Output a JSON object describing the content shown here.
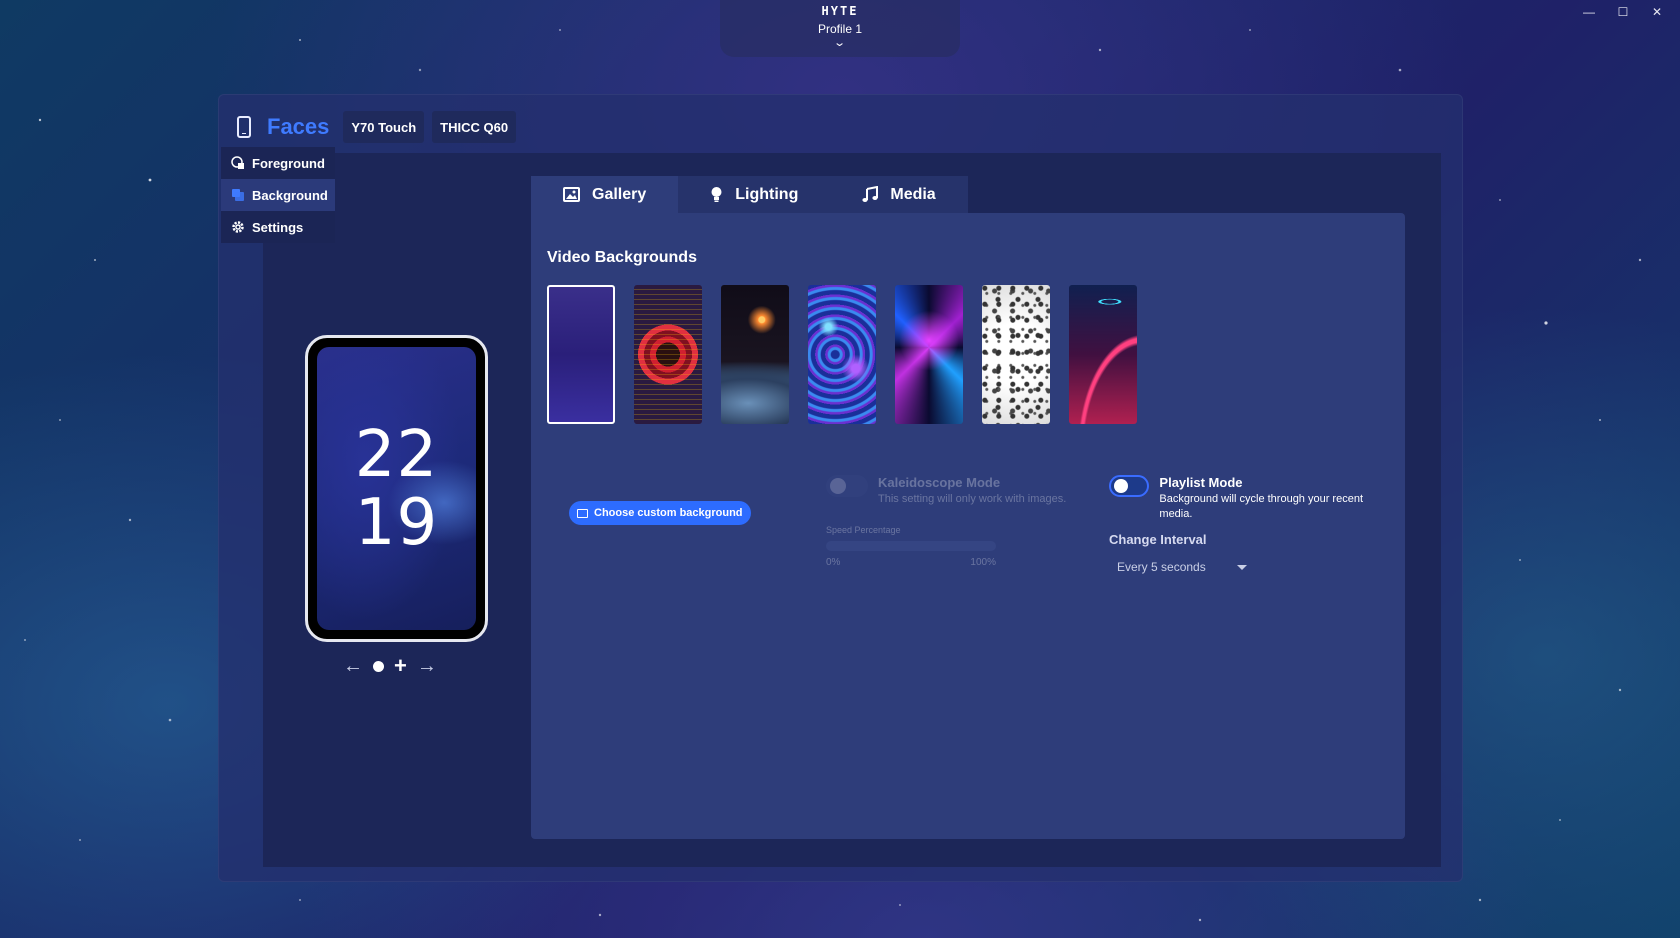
{
  "app": {
    "brand": "HYTE",
    "profile": "Profile 1"
  },
  "window_controls": {
    "minimize": "—",
    "maximize": "☐",
    "close": "✕"
  },
  "header": {
    "title": "Faces",
    "devices": [
      "Y70 Touch",
      "THICC Q60"
    ]
  },
  "sidebar": {
    "items": [
      {
        "label": "Foreground",
        "icon": "foreground-icon",
        "active": false
      },
      {
        "label": "Background",
        "icon": "background-icon",
        "active": true
      },
      {
        "label": "Settings",
        "icon": "gear-icon",
        "active": false
      }
    ]
  },
  "preview": {
    "hour": "22",
    "minute": "19",
    "pager": {
      "prev": "←",
      "add": "+",
      "next": "→"
    }
  },
  "tabs": [
    {
      "label": "Gallery",
      "icon": "image-icon",
      "active": true
    },
    {
      "label": "Lighting",
      "icon": "bulb-icon",
      "active": false
    },
    {
      "label": "Media",
      "icon": "music-icon",
      "active": false
    }
  ],
  "gallery": {
    "section_title": "Video Backgrounds",
    "thumbnails": [
      {
        "name": "purple-space",
        "selected": true
      },
      {
        "name": "red-tunnel",
        "selected": false
      },
      {
        "name": "earth-sunrise",
        "selected": false
      },
      {
        "name": "liquid-swirl",
        "selected": false
      },
      {
        "name": "neon-warp",
        "selected": false
      },
      {
        "name": "white-particles",
        "selected": false
      },
      {
        "name": "neon-rings",
        "selected": false
      }
    ],
    "custom_button": "Choose custom background",
    "kaleidoscope": {
      "title": "Kaleidoscope Mode",
      "description": "This setting will only work with images.",
      "speed_label": "Speed Percentage",
      "speed_min": "0%",
      "speed_max": "100%",
      "enabled": false
    },
    "playlist": {
      "title": "Playlist Mode",
      "description": "Background will cycle through your recent media.",
      "enabled": false
    },
    "interval": {
      "label": "Change Interval",
      "value": "Every 5 seconds"
    }
  },
  "colors": {
    "accent": "#3f7bff",
    "button": "#2d6cff",
    "panel": "#2e3d7a"
  }
}
